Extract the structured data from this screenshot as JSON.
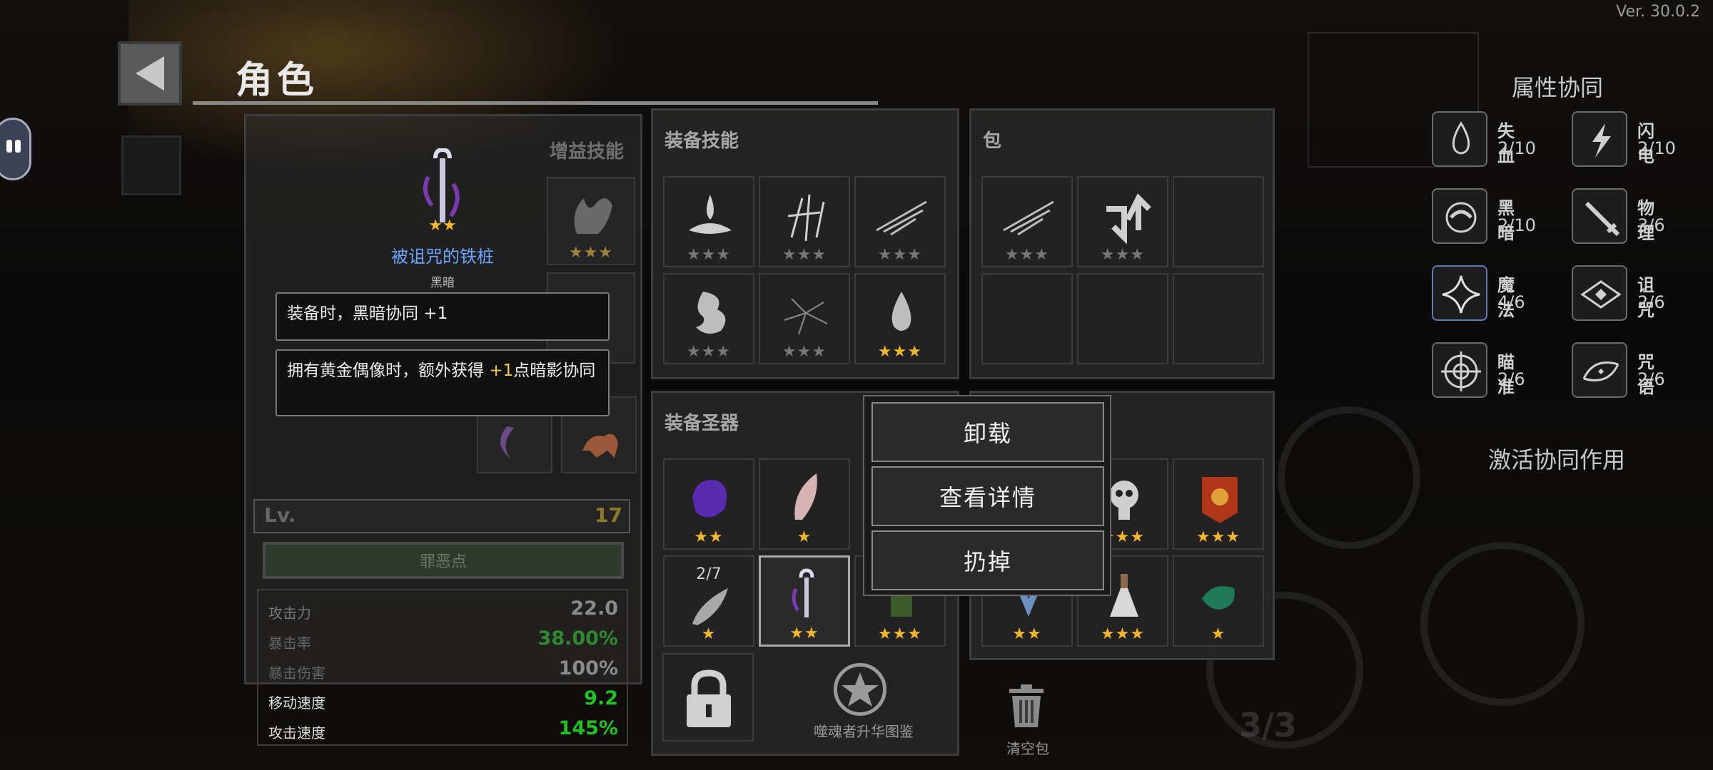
{
  "version": "Ver. 30.0.2",
  "header": {
    "title": "角色"
  },
  "character": {
    "buff_skills_title": "增益技能",
    "weapon_name": "被诅咒的铁桩",
    "weapon_synergy": "黑暗",
    "weapon_stars": "★★",
    "tooltip_line1": "装备时，黑暗协同 +1",
    "tooltip_line2_prefix": "拥有黄金偶像时，额外获得 ",
    "tooltip_line2_highlight": "+1",
    "tooltip_line2_suffix": "点暗影协同",
    "level_label": "Lv.",
    "level_value": "17",
    "sin_points_label": "罪恶点",
    "stats": [
      {
        "label": "攻击力",
        "value": "22.0",
        "color": "#9a9a9a"
      },
      {
        "label": "暴击率",
        "value": "38.00%",
        "color": "#2f8a2f"
      },
      {
        "label": "暴击伤害",
        "value": "100%",
        "color": "#9a9a9a"
      },
      {
        "label": "移动速度",
        "value": "9.2",
        "color": "#22c122"
      },
      {
        "label": "攻击速度",
        "value": "145%",
        "color": "#22c122"
      }
    ]
  },
  "equip_skills": {
    "title": "装备技能",
    "slots": [
      {
        "icon": "water-splash-icon",
        "stars": "★★★",
        "gold": 0
      },
      {
        "icon": "blades-icon",
        "stars": "★★★",
        "gold": 0
      },
      {
        "icon": "slash-icon",
        "stars": "★★★",
        "gold": 0
      },
      {
        "icon": "ghost-dragon-icon",
        "stars": "★★★",
        "gold": 0
      },
      {
        "icon": "crack-icon",
        "stars": "★★★",
        "gold": 0
      },
      {
        "icon": "drop-icon",
        "stars": "★★★",
        "gold": 3
      }
    ]
  },
  "bag": {
    "title": "包",
    "slots": [
      {
        "icon": "slash-icon",
        "stars": "★★★",
        "gold": 0
      },
      {
        "icon": "arrows-icon",
        "stars": "★★★",
        "gold": 0
      },
      {
        "icon": "",
        "stars": "",
        "gold": 0
      },
      {
        "icon": "",
        "stars": "",
        "gold": 0
      },
      {
        "icon": "",
        "stars": "",
        "gold": 0
      },
      {
        "icon": "",
        "stars": "",
        "gold": 0
      }
    ]
  },
  "relics": {
    "title": "装备圣器",
    "feather_count": "2/7",
    "codex_label": "噬魂者升华图鉴",
    "trash_label": "清空包"
  },
  "context_menu": {
    "unequip": "卸载",
    "details": "查看详情",
    "discard": "扔掉"
  },
  "synergy": {
    "title": "属性协同",
    "activate_label": "激活协同作用",
    "items": [
      {
        "name": "失血",
        "value": "2/10",
        "icon": "blood-icon"
      },
      {
        "name": "闪电",
        "value": "2/10",
        "icon": "lightning-icon"
      },
      {
        "name": "黑暗",
        "value": "2/10",
        "icon": "dark-swirl-icon"
      },
      {
        "name": "物理",
        "value": "3/6",
        "icon": "sword-icon"
      },
      {
        "name": "魔法",
        "value": "4/6",
        "icon": "magic-star-icon"
      },
      {
        "name": "诅咒",
        "value": "2/6",
        "icon": "curse-eye-icon"
      },
      {
        "name": "瞄准",
        "value": "2/6",
        "icon": "crosshair-icon"
      },
      {
        "name": "咒语",
        "value": "2/6",
        "icon": "spell-icon"
      }
    ]
  },
  "hud": {
    "ammo": "3/3"
  }
}
